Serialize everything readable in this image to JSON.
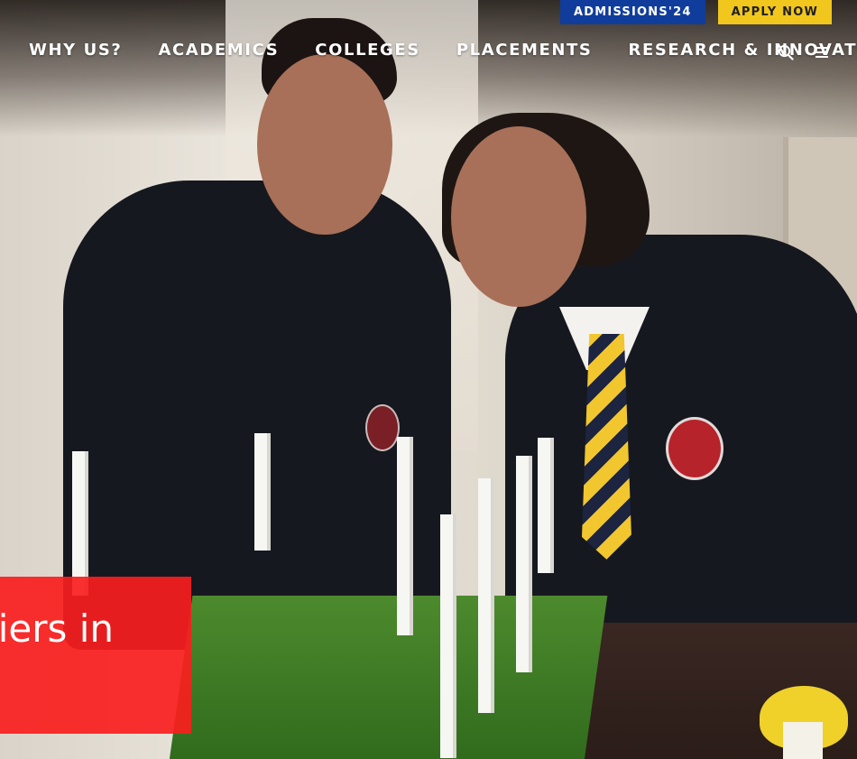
{
  "utility_bar": {
    "admissions_label": "ADMISSIONS'24",
    "apply_label": "APPLY NOW"
  },
  "nav": {
    "items": [
      {
        "label": "WHY US?"
      },
      {
        "label": "ACADEMICS"
      },
      {
        "label": "COLLEGES"
      },
      {
        "label": "PLACEMENTS"
      },
      {
        "label": "RESEARCH & INNOVATION"
      }
    ],
    "icons": [
      "search-icon",
      "hamburger-menu-icon"
    ]
  },
  "hero": {
    "caption": "iers in"
  },
  "colors": {
    "admissions_bg": "#103d9c",
    "apply_bg": "#f1c61d",
    "hero_caption_bg": "#f81e1e"
  }
}
